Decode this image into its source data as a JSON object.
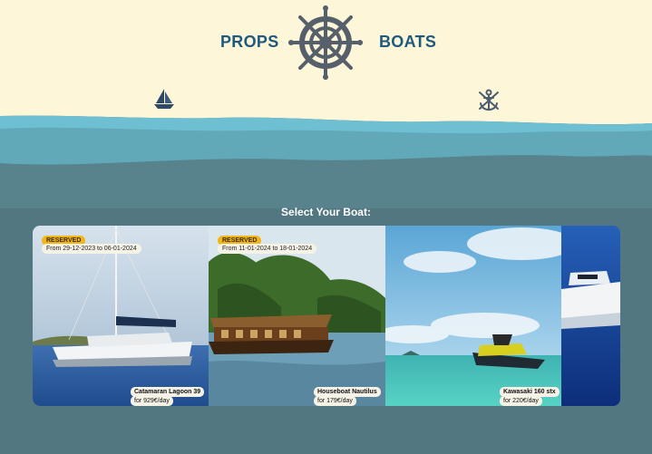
{
  "header": {
    "brand_left": "PROPS",
    "brand_right": "BOATS",
    "logo_icon": "ship-wheel-icon",
    "left_icon": "sailboat-icon",
    "right_icon": "anchor-icon",
    "colors": {
      "sand": "#fdf6d8",
      "wave_light": "#6ab7c9",
      "wave_mid": "#5fa2b2",
      "wave_dark": "#527780",
      "brand_text": "#1f5a7d"
    }
  },
  "main": {
    "section_title": "Select Your Boat:",
    "boats": [
      {
        "name": "Catamaran Lagoon 39",
        "price": "for 929€/day",
        "status": "RESERVED",
        "dates": "From 29-12-2023 to 06-01-2024"
      },
      {
        "name": "Houseboat Nautilus",
        "price": "for 179€/day",
        "status": "RESERVED",
        "dates": "From 11-01-2024 to 18-01-2024"
      },
      {
        "name": "Kawasaki 160 stx",
        "price": "for 220€/day"
      },
      {
        "name": "",
        "price": ""
      }
    ]
  }
}
